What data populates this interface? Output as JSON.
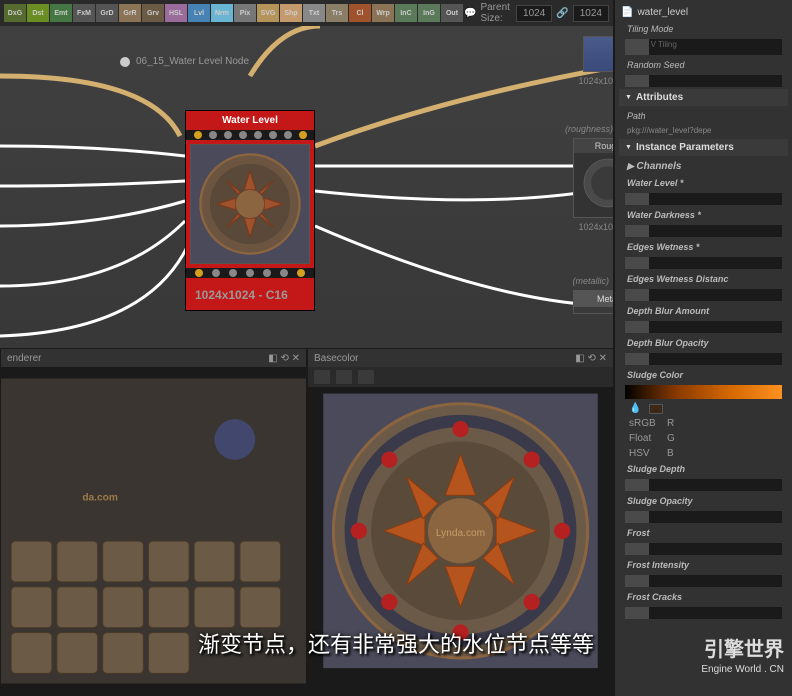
{
  "toolbar": {
    "items": [
      {
        "label": "DxG",
        "bg": "#556b2f"
      },
      {
        "label": "Dst",
        "bg": "#6b8e23"
      },
      {
        "label": "Emt",
        "bg": "#447744"
      },
      {
        "label": "FxM",
        "bg": "#555555"
      },
      {
        "label": "GrD",
        "bg": "#555555"
      },
      {
        "label": "GrR",
        "bg": "#8b7355"
      },
      {
        "label": "Grv",
        "bg": "#6b5b45"
      },
      {
        "label": "HSL",
        "bg": "#9b6b9b"
      },
      {
        "label": "Lvl",
        "bg": "#4682b4"
      },
      {
        "label": "Nrm",
        "bg": "#6bb5d4"
      },
      {
        "label": "Pix",
        "bg": "#777777"
      },
      {
        "label": "SVG",
        "bg": "#b5945a"
      },
      {
        "label": "Shp",
        "bg": "#c49a6c"
      },
      {
        "label": "Txt",
        "bg": "#888888"
      },
      {
        "label": "Trs",
        "bg": "#8b7e66"
      },
      {
        "label": "Cl",
        "bg": "#a0522d"
      },
      {
        "label": "Wrp",
        "bg": "#8b7355"
      },
      {
        "label": "InC",
        "bg": "#5a7a5a"
      },
      {
        "label": "InG",
        "bg": "#5a7a5a"
      },
      {
        "label": "Out",
        "bg": "#555555"
      }
    ],
    "parent_size_label": "Parent Size:",
    "parent_w": "1024",
    "parent_h": "1024"
  },
  "graph": {
    "title": "06_15_Water Level Node",
    "node_title": "Water Level",
    "node_size": "1024x1024 - C16",
    "thumbs": [
      {
        "label": "1024x10",
        "sub": ""
      },
      {
        "label": "1024x10",
        "sub": "(roughness)",
        "title": "Rough"
      },
      {
        "label": "",
        "sub": "(metallic)",
        "title": "Metal"
      }
    ]
  },
  "props": {
    "file": "water_level",
    "tiling_label": "Tiling Mode",
    "tiling_value": "H and V Tiling",
    "seed_label": "Random Seed",
    "sec_attributes": "Attributes",
    "path_label": "Path",
    "path_value": "pkg:///water_level?depe",
    "sec_instance": "Instance Parameters",
    "channels": "Channels",
    "params": [
      "Water Level *",
      "Water Darkness *",
      "Edges Wetness *",
      "Edges Wetness Distanc",
      "Depth Blur Amount",
      "Depth Blur Opacity"
    ],
    "sludge_color": "Sludge Color",
    "color_modes": [
      "sRGB",
      "Float",
      "HSV"
    ],
    "color_ch": [
      "R",
      "G",
      "B"
    ],
    "params2": [
      "Sludge Depth",
      "Sludge Opacity",
      "Frost",
      "Frost Intensity",
      "Frost Cracks"
    ]
  },
  "viewers": {
    "left_title": "enderer",
    "right_title": "Basecolor",
    "render_text": "da.com",
    "preview_text": "Lynda.com"
  },
  "subtitle": "渐变节点，还有非常强大的水位节点等等",
  "watermark": {
    "logo": "引擎世界",
    "url": "Engine World . CN"
  }
}
